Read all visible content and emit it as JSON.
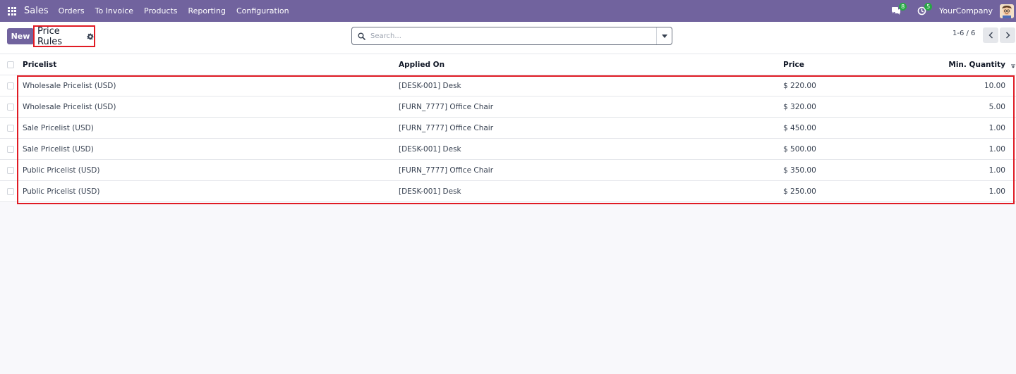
{
  "navbar": {
    "brand": "Sales",
    "menu": [
      "Orders",
      "To Invoice",
      "Products",
      "Reporting",
      "Configuration"
    ],
    "messages_count": "8",
    "activities_count": "5",
    "company": "YourCompany"
  },
  "control": {
    "new_label": "New",
    "title": "Price Rules",
    "search_placeholder": "Search...",
    "pager": "1-6 / 6"
  },
  "table": {
    "columns": [
      "Pricelist",
      "Applied On",
      "Price",
      "Min. Quantity"
    ],
    "rows": [
      {
        "pricelist": "Wholesale Pricelist (USD)",
        "applied_on": "[DESK-001] Desk",
        "price": "$ 220.00",
        "min_qty": "10.00"
      },
      {
        "pricelist": "Wholesale Pricelist (USD)",
        "applied_on": "[FURN_7777] Office Chair",
        "price": "$ 320.00",
        "min_qty": "5.00"
      },
      {
        "pricelist": "Sale Pricelist (USD)",
        "applied_on": "[FURN_7777] Office Chair",
        "price": "$ 450.00",
        "min_qty": "1.00"
      },
      {
        "pricelist": "Sale Pricelist (USD)",
        "applied_on": "[DESK-001] Desk",
        "price": "$ 500.00",
        "min_qty": "1.00"
      },
      {
        "pricelist": "Public Pricelist (USD)",
        "applied_on": "[FURN_7777] Office Chair",
        "price": "$ 350.00",
        "min_qty": "1.00"
      },
      {
        "pricelist": "Public Pricelist (USD)",
        "applied_on": "[DESK-001] Desk",
        "price": "$ 250.00",
        "min_qty": "1.00"
      }
    ]
  },
  "colors": {
    "brand": "#71639e",
    "highlight": "#e01b24",
    "badge": "#28a745"
  }
}
